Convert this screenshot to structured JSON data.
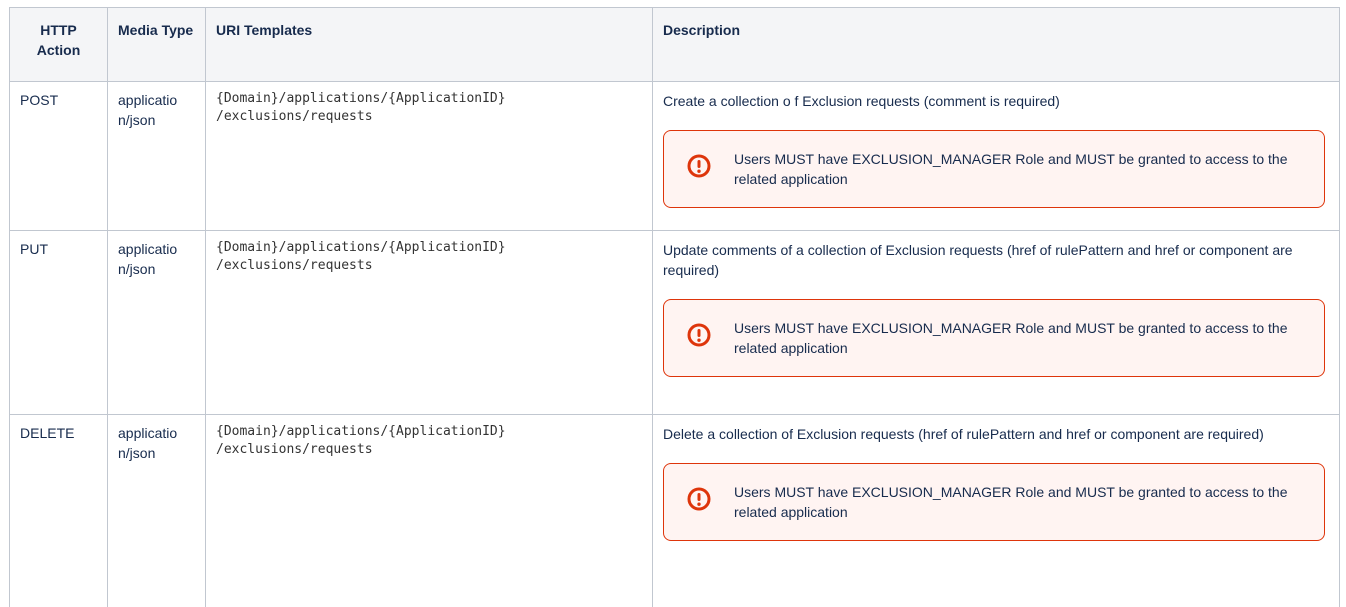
{
  "table": {
    "headers": {
      "http_action": "HTTP Action",
      "media_type": "Media Type",
      "uri_templates": "URI Templates",
      "description": "Description"
    },
    "rows": [
      {
        "action": "POST",
        "media_type": "applicatio n/json",
        "uri_line1": "{Domain}/applications/{ApplicationID}",
        "uri_line2": "/exclusions/requests",
        "description": "Create a collection o f Exclusion requests (comment is required)",
        "panel_text": "Users MUST have EXCLUSION_MANAGER Role and MUST be granted to access to the related application"
      },
      {
        "action": "PUT",
        "media_type": "applicatio n/json",
        "uri_line1": "{Domain}/applications/{ApplicationID}",
        "uri_line2": "/exclusions/requests",
        "description": "Update comments of a collection of Exclusion requests (href of rulePattern and href or component are required)",
        "panel_text": "Users MUST have EXCLUSION_MANAGER Role and MUST be granted to access to the related application"
      },
      {
        "action": "DELETE",
        "media_type": "applicatio n/json",
        "uri_line1": "{Domain}/applications/{ApplicationID}",
        "uri_line2": "/exclusions/requests",
        "description": "Delete a collection of Exclusion requests (href of rulePattern and href or component are required)",
        "panel_text": "Users MUST have EXCLUSION_MANAGER Role and MUST be granted to access to the related application"
      }
    ]
  },
  "colors": {
    "border": "#c1c7d0",
    "header_bg": "#f4f5f7",
    "panel_border": "#de350b",
    "panel_bg": "#fff4f2",
    "icon_red": "#de350b"
  },
  "icons": {
    "panel_icon": "error-exclamation-circle-icon"
  }
}
